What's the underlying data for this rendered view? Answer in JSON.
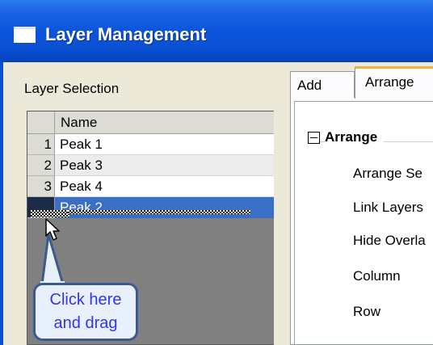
{
  "window": {
    "title": "Layer Management"
  },
  "layer_selection": {
    "label": "Layer Selection",
    "column_header": "Name",
    "rows": [
      {
        "num": "1",
        "name": "Peak 1"
      },
      {
        "num": "2",
        "name": "Peak 3"
      },
      {
        "num": "3",
        "name": "Peak 4"
      },
      {
        "num": "",
        "name": "Peak 2"
      }
    ]
  },
  "callout": {
    "line1": "Click here",
    "line2": "and drag"
  },
  "tabs": [
    {
      "label": "Add"
    },
    {
      "label": "Arrange"
    }
  ],
  "arrange_panel": {
    "group_title": "Arrange",
    "properties": [
      "Arrange Se",
      "Link Layers",
      "Hide Overla",
      "Column",
      "Row"
    ]
  },
  "colors": {
    "title_bar": "#0a55db",
    "selected_row": "#3a6fc6",
    "callout_text": "#3333ee",
    "tab_highlight": "#f0b43a"
  }
}
